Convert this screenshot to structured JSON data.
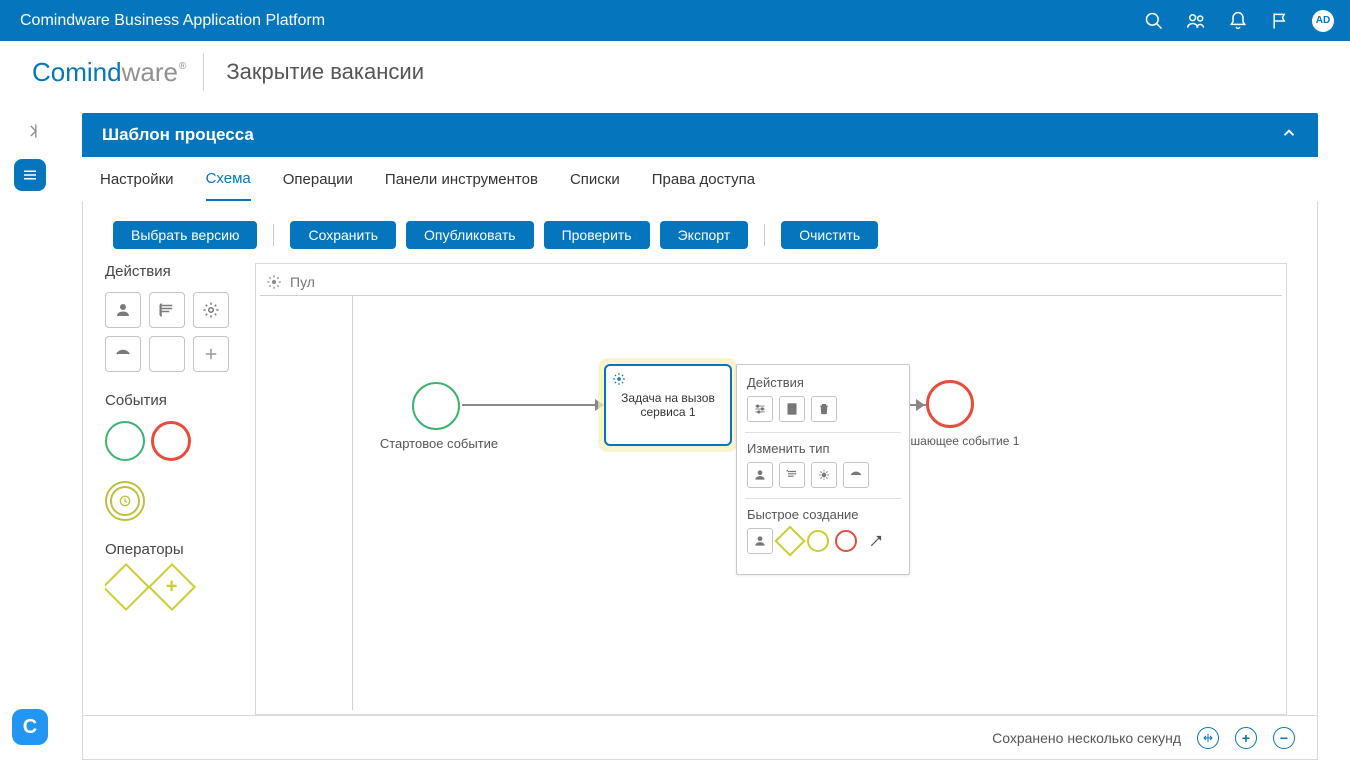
{
  "topbar": {
    "title": "Comindware Business Application Platform",
    "avatar_initials": "AD"
  },
  "header": {
    "logo_main": "Comind",
    "logo_tail": "ware",
    "breadcrumb": "Закрытие вакансии"
  },
  "panel": {
    "title": "Шаблон процесса"
  },
  "tabs": [
    {
      "label": "Настройки",
      "active": false
    },
    {
      "label": "Схема",
      "active": true
    },
    {
      "label": "Операции",
      "active": false
    },
    {
      "label": "Панели инструментов",
      "active": false
    },
    {
      "label": "Списки",
      "active": false
    },
    {
      "label": "Права доступа",
      "active": false
    }
  ],
  "toolbar": {
    "select_version": "Выбрать версию",
    "save": "Сохранить",
    "publish": "Опубликовать",
    "check": "Проверить",
    "export": "Экспорт",
    "clear": "Очистить"
  },
  "palette": {
    "actions_label": "Действия",
    "events_label": "События",
    "operators_label": "Операторы"
  },
  "canvas": {
    "pool_label": "Пул",
    "start_label": "Стартовое событие",
    "task_label": "Задача на вызов сервиса 1",
    "end_label": "шающее событие 1"
  },
  "context_menu": {
    "actions_label": "Действия",
    "change_type_label": "Изменить тип",
    "quick_create_label": "Быстрое создание"
  },
  "footer": {
    "saved": "Сохранено несколько секунд"
  }
}
